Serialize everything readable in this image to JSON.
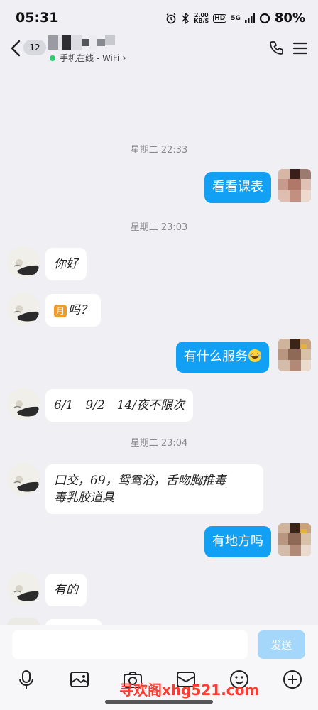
{
  "status_bar": {
    "time": "05:31",
    "net_speed_value": "2.00",
    "net_speed_unit": "KB/S",
    "hd_label": "HD",
    "signal_label": "5G",
    "battery_percent": "80%"
  },
  "header": {
    "unread_count": "12",
    "online_status": "手机在线 - WiFi",
    "online_chevron": "›"
  },
  "messages": [
    {
      "type": "time",
      "text": "星期二 22:33"
    },
    {
      "type": "out",
      "text": "看看课表"
    },
    {
      "type": "time",
      "text": "星期二 23:03"
    },
    {
      "type": "in",
      "text": "你好"
    },
    {
      "type": "in",
      "emoji": "月",
      "text": "吗？"
    },
    {
      "type": "out",
      "text": "有什么服务"
    },
    {
      "type": "in",
      "text": "6/1　9/2　14/夜不限次"
    },
    {
      "type": "time",
      "text": "星期二 23:04"
    },
    {
      "type": "in",
      "line1": "口交，69，鸳鸯浴，舌吻胸推毒",
      "line2": "毒乳胶道具"
    },
    {
      "type": "out",
      "text": "有地方吗"
    },
    {
      "type": "in",
      "text": "有的"
    }
  ],
  "input": {
    "value": "",
    "send_label": "发送"
  },
  "watermark": "寻欢阁xhg521.com",
  "colors": {
    "bubble_out": "#12a0f5",
    "send_disabled": "#a5d7fb",
    "online_dot": "#2ecc71",
    "watermark": "#ff3b30"
  },
  "icons": [
    "back-icon",
    "phone-icon",
    "menu-icon",
    "microphone-icon",
    "picture-icon",
    "camera-icon",
    "folder-icon",
    "emoji-icon",
    "plus-icon"
  ]
}
